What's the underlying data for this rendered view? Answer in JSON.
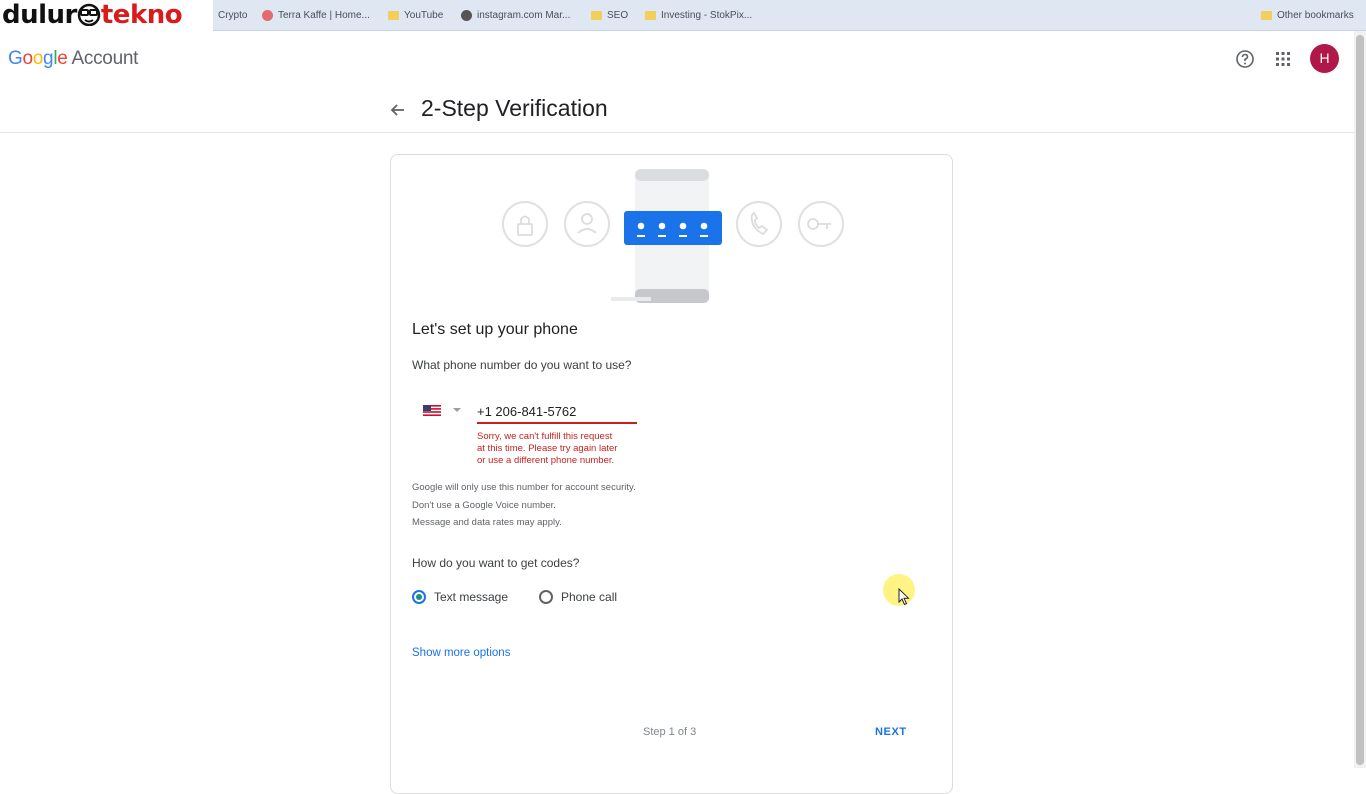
{
  "watermark": {
    "part1": "dulur",
    "part2": "tekno"
  },
  "bookmarks": {
    "items": [
      {
        "label": "Crypto",
        "icon": "folder-icon"
      },
      {
        "label": "Terra Kaffe | Home...",
        "icon": "favicon"
      },
      {
        "label": "YouTube",
        "icon": "folder-icon"
      },
      {
        "label": "instagram.com Mar...",
        "icon": "favicon"
      },
      {
        "label": "SEO",
        "icon": "folder-icon"
      },
      {
        "label": "Investing - StokPix...",
        "icon": "folder-icon"
      }
    ],
    "other": "Other bookmarks"
  },
  "header": {
    "logo_google": [
      "G",
      "o",
      "o",
      "g",
      "l",
      "e"
    ],
    "logo_account": "Account",
    "avatar_initial": "H"
  },
  "page": {
    "title": "2-Step Verification"
  },
  "card": {
    "title": "Let's set up your phone",
    "phone_question": "What phone number do you want to use?",
    "phone_value": "+1 206-841-5762",
    "error_lines": [
      "Sorry, we can't fulfill this request",
      "at this time. Please try again later",
      "or use a different phone number."
    ],
    "note_lines": [
      "Google will only use this number for account security.",
      "Don't use a Google Voice number.",
      "Message and data rates may apply."
    ],
    "codes_question": "How do you want to get codes?",
    "options": [
      {
        "label": "Text message",
        "checked": true
      },
      {
        "label": "Phone call",
        "checked": false
      }
    ],
    "more_options": "Show more options",
    "step": "Step 1 of 3",
    "next": "NEXT"
  },
  "colors": {
    "accent": "#1a73e8",
    "error": "#c5221f",
    "avatar": "#b0184a",
    "radio_checked": "#1e8e7e"
  }
}
